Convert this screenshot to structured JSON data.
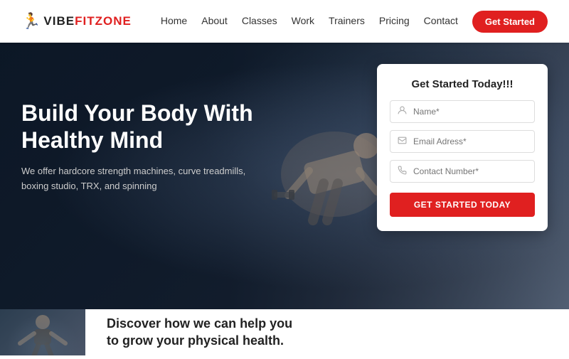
{
  "navbar": {
    "logo_text": "VIBEFITZONE",
    "nav_items": [
      {
        "label": "Home",
        "href": "#"
      },
      {
        "label": "About",
        "href": "#"
      },
      {
        "label": "Classes",
        "href": "#"
      },
      {
        "label": "Work",
        "href": "#"
      },
      {
        "label": "Trainers",
        "href": "#"
      },
      {
        "label": "Pricing",
        "href": "#"
      },
      {
        "label": "Contact",
        "href": "#"
      }
    ],
    "cta_button": "Get Started"
  },
  "hero": {
    "heading_line1": "Build Your Body With",
    "heading_line2": "Healthy Mind",
    "description": "We offer hardcore strength machines, curve treadmills,\nboxing studio, TRX, and spinning"
  },
  "form": {
    "title": "Get Started Today!!!",
    "name_placeholder": "Name*",
    "email_placeholder": "Email Adress*",
    "phone_placeholder": "Contact Number*",
    "submit_label": "GET STARTED TODAY"
  },
  "bottom": {
    "heading": "Discover how we can help you\nto grow your physical health."
  },
  "icons": {
    "runner": "🏃",
    "user": "👤",
    "email": "✉",
    "phone": "📞"
  }
}
